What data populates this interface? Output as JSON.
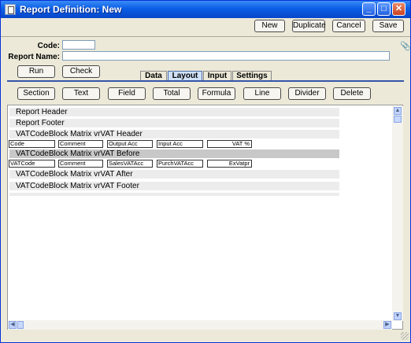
{
  "window": {
    "title": "Report Definition: New"
  },
  "titlebar_buttons": {
    "minimize": "_",
    "maximize": "□",
    "close": "✕"
  },
  "toolbar": {
    "new": "New",
    "duplicate": "Duplicate",
    "cancel": "Cancel",
    "save": "Save"
  },
  "form": {
    "code_label": "Code:",
    "code_value": "",
    "report_name_label": "Report Name:",
    "report_name_value": ""
  },
  "actions": {
    "run": "Run",
    "check": "Check"
  },
  "tabs": [
    "Data",
    "Layout",
    "Input",
    "Settings"
  ],
  "active_tab": "Layout",
  "layout_buttons": [
    "Section",
    "Text",
    "Field",
    "Total",
    "Formula",
    "Line",
    "Divider",
    "Delete"
  ],
  "bands": [
    {
      "label": "Report Header"
    },
    {
      "label": "Report Footer"
    },
    {
      "label": "VATCodeBlock Matrix vrVAT Header"
    },
    {
      "label": "VATCodeBlock Matrix vrVAT Before"
    },
    {
      "label": "VATCodeBlock Matrix vrVAT After"
    },
    {
      "label": "VATCodeBlock Matrix vrVAT Footer"
    }
  ],
  "header_fields": [
    "Code",
    "Comment",
    "Output Acc",
    "Input Acc",
    "VAT %"
  ],
  "before_fields": [
    "VATCode",
    "Comment",
    "SalesVATAcc",
    "PurchVATAcc",
    "ExVatpr"
  ]
}
